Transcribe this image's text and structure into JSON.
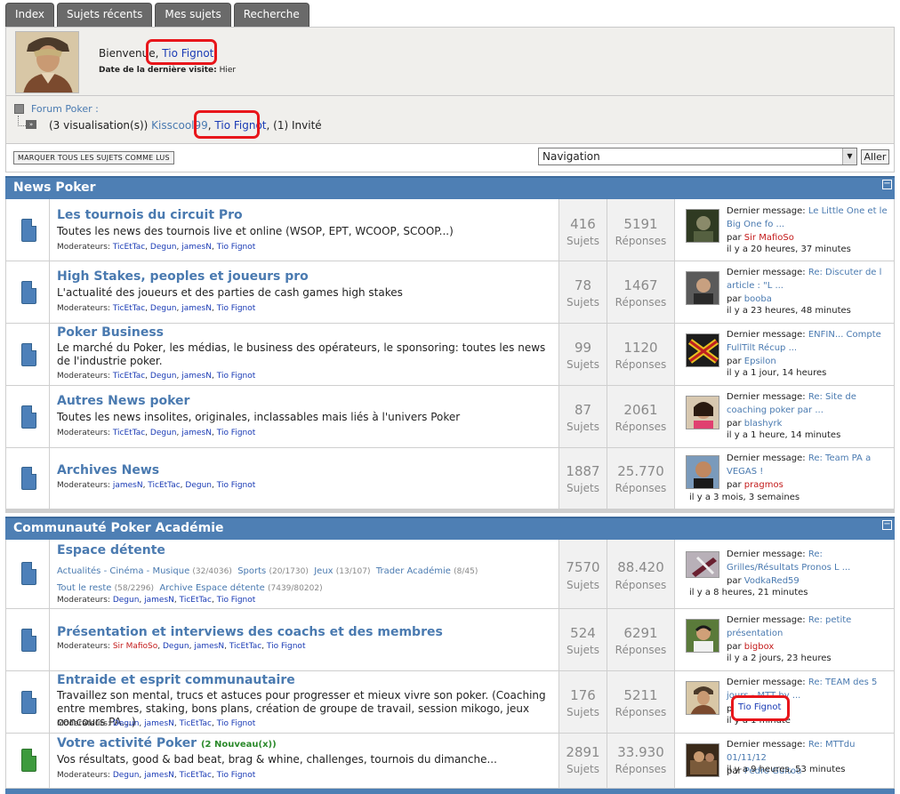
{
  "tabs": [
    "Index",
    "Sujets récents",
    "Mes sujets",
    "Recherche"
  ],
  "welcome": {
    "greeting": "Bienvenue,",
    "username": "Tio Fignot",
    "last_visit_label": "Date de la dernière visite:",
    "last_visit_value": "Hier"
  },
  "breadcrumb": {
    "forum_link": "Forum Poker :",
    "viewers_prefix": "(3 visualisation(s))",
    "viewer1": "Kisscool99",
    "viewer2": "Tio Fignot",
    "viewers_suffix": "(1) Invité"
  },
  "toolbar": {
    "mark_read": "Marquer tous les sujets comme lus",
    "nav_select": "Navigation",
    "go_button": "Aller"
  },
  "categories": [
    {
      "title": "News Poker",
      "forums": [
        {
          "title": "Les tournois du circuit Pro",
          "desc": "Toutes les news des tournois live et online (WSOP, EPT, WCOOP, SCOOP...)",
          "mods_label": "Moderateurs:",
          "mods": [
            "TicEtTac",
            "Degun",
            "jamesN",
            "Tio Fignot"
          ],
          "topics": "416",
          "posts": "5191",
          "last_label": "Dernier message:",
          "last_title": "Le Little One et le Big One fo ...",
          "last_by": "par",
          "last_user": "Sir MafioSo",
          "last_time": "il y a 20 heures, 37 minutes"
        },
        {
          "title": "High Stakes, peoples et joueurs pro",
          "desc": "L'actualité des joueurs et des parties de cash games high stakes",
          "mods_label": "Moderateurs:",
          "mods": [
            "TicEtTac",
            "Degun",
            "jamesN",
            "Tio Fignot"
          ],
          "topics": "78",
          "posts": "1467",
          "last_label": "Dernier message:",
          "last_title": "Re: Discuter de l article : \"L ...",
          "last_by": "par",
          "last_user": "booba",
          "last_time": "il y a 23 heures, 48 minutes"
        },
        {
          "title": "Poker Business",
          "desc": "Le marché du Poker, les médias, le business des opérateurs, le sponsoring: toutes les news de l'industrie poker.",
          "mods_label": "Moderateurs:",
          "mods": [
            "TicEtTac",
            "Degun",
            "jamesN",
            "Tio Fignot"
          ],
          "topics": "99",
          "posts": "1120",
          "last_label": "Dernier message:",
          "last_title": "ENFIN... Compte FullTilt Récup ...",
          "last_by": "par",
          "last_user": "Epsilon",
          "last_time": "il y a 1 jour, 14 heures"
        },
        {
          "title": "Autres News poker",
          "desc": "Toutes les news insolites, originales, inclassables mais liés à l'univers Poker",
          "mods_label": "Moderateurs:",
          "mods": [
            "TicEtTac",
            "Degun",
            "jamesN",
            "Tio Fignot"
          ],
          "topics": "87",
          "posts": "2061",
          "last_label": "Dernier message:",
          "last_title": "Re: Site de coaching poker par ...",
          "last_by": "par",
          "last_user": "blashyrk",
          "last_time": "il y a 1 heure, 14 minutes"
        },
        {
          "title": "Archives News",
          "desc": "",
          "mods_label": "Moderateurs:",
          "mods": [
            "jamesN",
            "TicEtTac",
            "Degun",
            "Tio Fignot"
          ],
          "topics": "1887",
          "posts": "25.770",
          "last_label": "Dernier message:",
          "last_title": "Re: Team PA a VEGAS !",
          "last_by": "par",
          "last_user": "pragmos",
          "last_time": "il y a 3 mois, 3 semaines"
        }
      ]
    },
    {
      "title": "Communauté Poker Académie",
      "forums": [
        {
          "title": "Espace détente",
          "subforums": [
            {
              "name": "Actualités - Cinéma - Musique",
              "count": "(32/4036)"
            },
            {
              "name": "Sports",
              "count": "(20/1730)"
            },
            {
              "name": "Jeux",
              "count": "(13/107)"
            },
            {
              "name": "Trader Académie",
              "count": "(8/45)"
            },
            {
              "name": "Tout le reste",
              "count": "(58/2296)"
            },
            {
              "name": "Archive Espace détente",
              "count": "(7439/80202)"
            }
          ],
          "mods_label": "Moderateurs:",
          "mods": [
            "Degun",
            "jamesN",
            "TicEtTac",
            "Tio Fignot"
          ],
          "topics": "7570",
          "posts": "88.420",
          "last_label": "Dernier message:",
          "last_title": "Re: Grilles/Résultats Pronos L ...",
          "last_by": "par",
          "last_user": "VodkaRed59",
          "last_time": "il y a 8 heures, 21 minutes"
        },
        {
          "title": "Présentation et interviews des coachs et des membres",
          "desc": "",
          "mods_label": "Moderateurs:",
          "mods": [
            "Sir MafioSo",
            "Degun",
            "jamesN",
            "TicEtTac",
            "Tio Fignot"
          ],
          "topics": "524",
          "posts": "6291",
          "last_label": "Dernier message:",
          "last_title": "Re: petite présentation",
          "last_by": "par",
          "last_user": "bigbox",
          "last_time": "il y a 2 jours, 23 heures"
        },
        {
          "title": "Entraide et esprit communautaire",
          "desc": "Travaillez son mental, trucs et astuces pour progresser et mieux vivre son poker. (Coaching entre membres, staking, bons plans, création de groupe de travail, session mikogo, jeux concours PA...)",
          "mods_label": "Moderateurs:",
          "mods": [
            "Degun",
            "jamesN",
            "TicEtTac",
            "Tio Fignot"
          ],
          "topics": "176",
          "posts": "5211",
          "last_label": "Dernier message:",
          "last_title": "Re: TEAM des 5 jours - MTT by ...",
          "last_by": "par",
          "last_user": "Tio Fignot",
          "last_time": "il y a 1 minute"
        },
        {
          "title": "Votre activité Poker",
          "new_badge": "(2 Nouveau(x))",
          "desc": "Vos résultats, good & bad beat, brag & whine, challenges, tournois du dimanche...",
          "mods_label": "Moderateurs:",
          "mods": [
            "Degun",
            "jamesN",
            "TicEtTac",
            "Tio Fignot"
          ],
          "topics": "2891",
          "posts": "33.930",
          "last_label": "Dernier message:",
          "last_title": "Re: MTTdu 01/11/12",
          "last_by": "par",
          "last_user": "Pedro Guitou",
          "last_time": "il y a 9 heures, 53 minutes"
        }
      ]
    }
  ],
  "labels": {
    "topics": "Sujets",
    "posts": "Réponses"
  }
}
